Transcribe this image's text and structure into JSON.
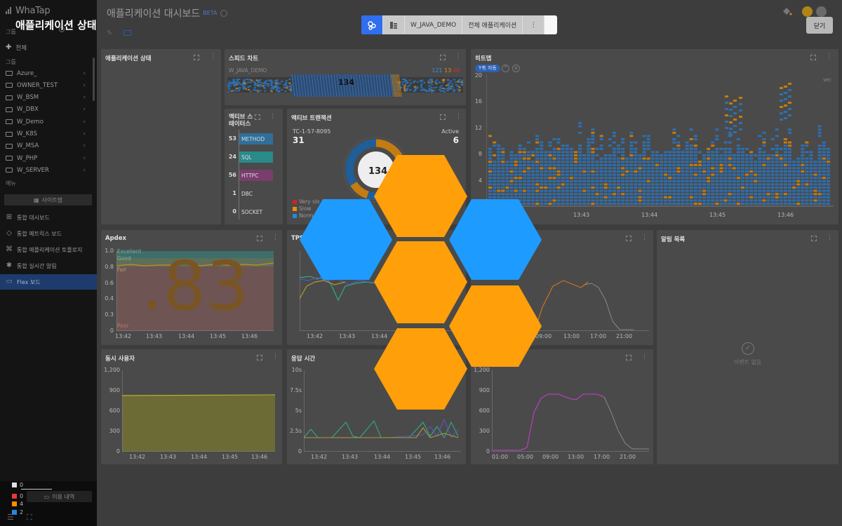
{
  "overlay_title": "애플리케이션 상태",
  "sidebar": {
    "logo": "WhaTap",
    "group_header": "그룹",
    "group_header_2": "그룹",
    "all_label": "전체",
    "groups": [
      "Azure_",
      "OWNER_TEST",
      "W_BSM",
      "W_DBX",
      "W_Demo",
      "W_K8S",
      "W_MSA",
      "W_PHP",
      "W_SERVER"
    ],
    "menu_header": "메뉴",
    "sitemap_label": "사이트맵",
    "nav": [
      {
        "label": "통합 대시보드",
        "icon": "grid-icon"
      },
      {
        "label": "통합 메트릭스 보드",
        "icon": "tag-icon"
      },
      {
        "label": "통합 애플리케이션 토폴로지",
        "icon": "topology-icon"
      },
      {
        "label": "통합 실시간 알림",
        "icon": "bug-icon"
      },
      {
        "label": "Flex 보드",
        "icon": "board-icon"
      }
    ],
    "status_counts": [
      {
        "value": "0",
        "color": "#e0e0e0"
      },
      {
        "value": "0",
        "color": "#e53935"
      },
      {
        "value": "4",
        "color": "#fb8c00"
      },
      {
        "value": "2",
        "color": "#1e88e5"
      }
    ],
    "usage_label": "이용 내역"
  },
  "header": {
    "title": "애플리케이션 대시보드",
    "beta": "BETA",
    "close_label": "닫기"
  },
  "toolbar": {
    "project": "W_JAVA_DEMO",
    "scope": "전체 애플리케이션",
    "more": "⋮"
  },
  "widgets": {
    "app_status": {
      "title": "애플리케이션 상태"
    },
    "speed_chart": {
      "title": "스피드 차트",
      "project": "W_JAVA_DEMO",
      "center_value": "134",
      "normal": "121",
      "slow": "13",
      "very_slow": "00"
    },
    "active_status": {
      "title": "액티브 스테이터스",
      "rows": [
        {
          "count": "53",
          "label": "METHOD",
          "color": "#2f6f9a"
        },
        {
          "count": "24",
          "label": "SQL",
          "color": "#2a8a8a"
        },
        {
          "count": "56",
          "label": "HTTPC",
          "color": "#7a3d6e"
        },
        {
          "count": "1",
          "label": "DBC",
          "color": "#4a4a4a"
        },
        {
          "count": "0",
          "label": "SOCKET",
          "color": "#4a4a4a"
        }
      ]
    },
    "active_tx": {
      "title": "액티브 트랜잭션",
      "agent": "TC-1-57-8095",
      "agent_value": "31",
      "active_label": "Active",
      "active_value": "6",
      "center": "134",
      "legend": [
        {
          "label": "Very slo",
          "color": "#c62828"
        },
        {
          "label": "Slow",
          "color": "#ef8f00"
        },
        {
          "label": "Norm",
          "color": "#1e88e5"
        }
      ]
    },
    "heatmap": {
      "title": "히트맵",
      "badge": "Y축 자동",
      "y_ticks": [
        "20",
        "16",
        "12",
        "8",
        "4",
        "0"
      ],
      "x_ticks": [
        "13:43",
        "13:44",
        "13:45",
        "13:46"
      ],
      "unit": "sec"
    },
    "apdex": {
      "title": "Apdex",
      "value": ".83",
      "y_ticks": [
        "1.0",
        "0.8",
        "0.6",
        "0.4",
        "0.3",
        "0"
      ],
      "x_ticks": [
        "13:42",
        "13:43",
        "13:44",
        "13:45",
        "13:46"
      ],
      "levels": [
        "Excellent",
        "Good",
        "Fair",
        "Poor"
      ]
    },
    "tps": {
      "title": "TPS",
      "y_ticks": [
        "",
        "",
        "",
        "",
        "",
        "0"
      ],
      "x_ticks": [
        "13:42",
        "13:43",
        "13:44"
      ]
    },
    "daily": {
      "x_ticks": [
        "09:00",
        "13:00",
        "17:00",
        "21:00"
      ]
    },
    "alerts": {
      "title": "알림 목록",
      "empty": "이벤트 없음"
    },
    "concurrent": {
      "title": "동시 사용자",
      "y_ticks": [
        "1,200",
        "900",
        "600",
        "300",
        "0"
      ],
      "x_ticks": [
        "13:42",
        "13:43",
        "13:44",
        "13:45",
        "13:46"
      ]
    },
    "resp_time": {
      "title": "응답 시간",
      "y_ticks": [
        "10s",
        "7.5s",
        "5s",
        "2.5s",
        "0"
      ],
      "x_ticks": [
        "13:42",
        "13:43",
        "13:44",
        "13:45",
        "13:46"
      ]
    },
    "daily_users": {
      "y_ticks": [
        "1,200",
        "900",
        "600",
        "300",
        "0"
      ],
      "x_ticks": [
        "01:00",
        "05:00",
        "09:00",
        "13:00",
        "17:00",
        "21:00"
      ]
    }
  },
  "colors": {
    "accent": "#2f6ff0",
    "hex_orange": "#ff9f0a",
    "hex_blue": "#1e9bff"
  }
}
